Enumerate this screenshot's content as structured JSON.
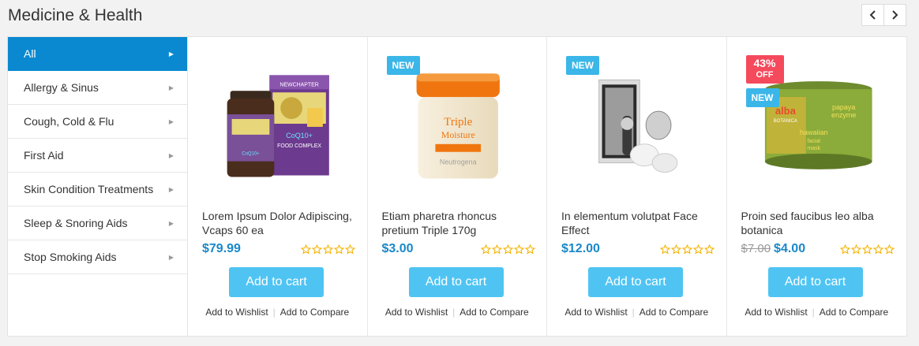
{
  "section": {
    "title": "Medicine & Health"
  },
  "nav": {
    "prev_icon": "chevron-left-icon",
    "next_icon": "chevron-right-icon"
  },
  "categories": [
    {
      "label": "All",
      "active": true
    },
    {
      "label": "Allergy & Sinus"
    },
    {
      "label": "Cough, Cold & Flu"
    },
    {
      "label": "First Aid"
    },
    {
      "label": "Skin Condition Treatments"
    },
    {
      "label": "Sleep & Snoring Aids"
    },
    {
      "label": "Stop Smoking Aids"
    }
  ],
  "products": [
    {
      "name": "Lorem Ipsum Dolor Adipiscing, Vcaps 60 ea",
      "price": "$79.99",
      "old_price": "",
      "badge_new": "",
      "badge_sale": "",
      "badge_sale_sub": "",
      "rating": 0,
      "image": "bottle-and-box-icon",
      "image_text": [
        "NEWCHAPTER",
        "CoQ10+",
        "FOOD COMPLEX"
      ]
    },
    {
      "name": "Etiam pharetra rhoncus pretium Triple 170g",
      "price": "$3.00",
      "old_price": "",
      "badge_new": "NEW",
      "badge_sale": "",
      "badge_sale_sub": "",
      "rating": 0,
      "image": "cream-jar-icon",
      "image_text": [
        "Triple",
        "Moisture",
        "Neutrogena"
      ]
    },
    {
      "name": "In elementum volutpat Face Effect",
      "price": "$12.00",
      "old_price": "",
      "badge_new": "NEW",
      "badge_sale": "",
      "badge_sale_sub": "",
      "rating": 0,
      "image": "face-brush-icon",
      "image_text": []
    },
    {
      "name": "Proin sed faucibus leo alba botanica",
      "price": "$4.00",
      "old_price": "$7.00",
      "badge_new": "NEW",
      "badge_sale": "43%",
      "badge_sale_sub": "OFF",
      "rating": 0,
      "image": "mask-jar-icon",
      "image_text": [
        "alba",
        "BOTANICA",
        "papaya",
        "enzyme",
        "hawaiian",
        "facial",
        "mask"
      ]
    }
  ],
  "actions": {
    "add_to_cart": "Add to cart",
    "wishlist": "Add to Wishlist",
    "compare": "Add to Compare"
  },
  "colors": {
    "accent": "#0a88d0",
    "price": "#1a88c9",
    "button": "#4fc4f3",
    "new_badge": "#3bb6e8",
    "sale_badge": "#f44a5c",
    "star": "#f5b301"
  }
}
